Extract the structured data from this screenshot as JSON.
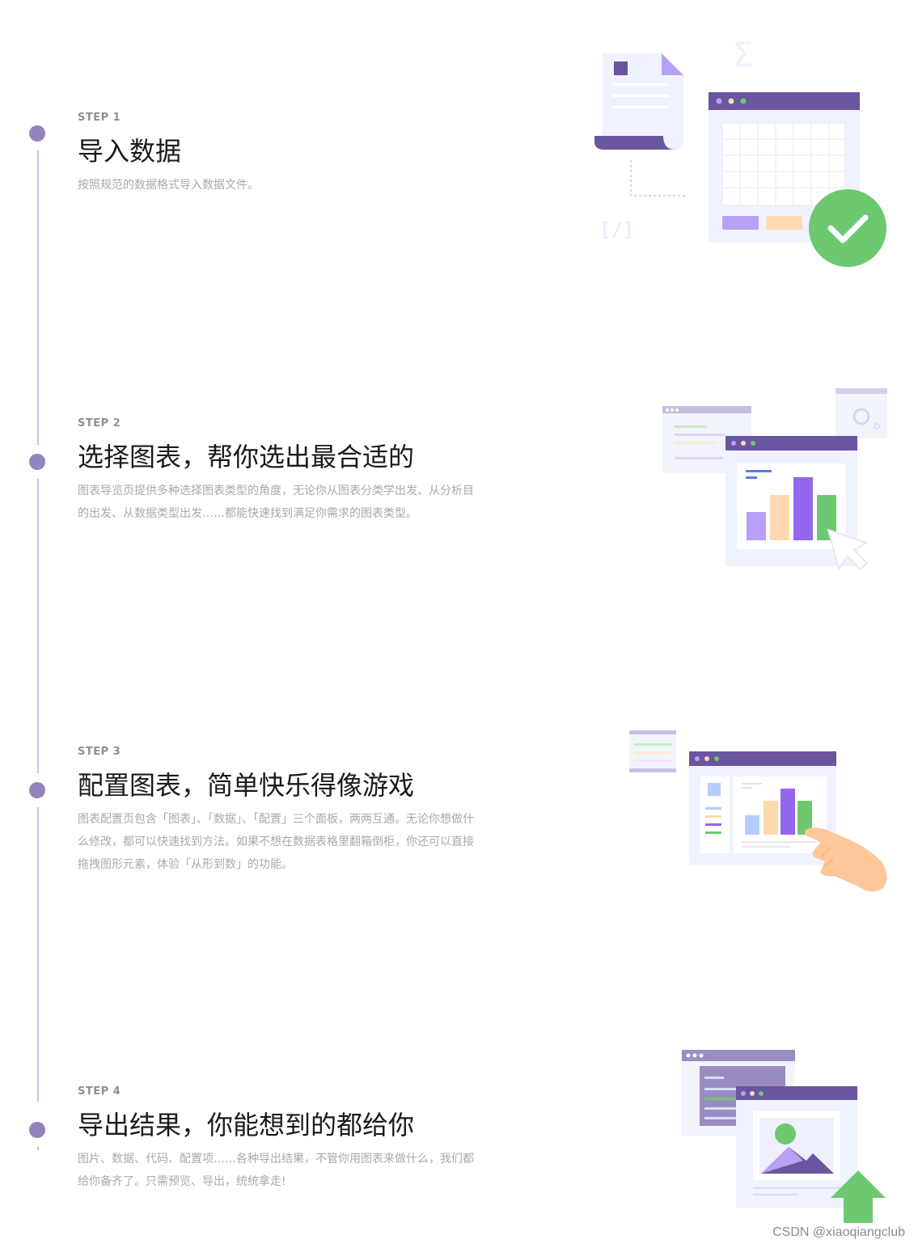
{
  "steps": [
    {
      "label": "STEP 1",
      "title": "导入数据",
      "desc": "按照规范的数据格式导入数据文件。"
    },
    {
      "label": "STEP 2",
      "title": "选择图表，帮你选出最合适的",
      "desc": "图表导览页提供多种选择图表类型的角度，无论你从图表分类学出发、从分析目的出发、从数据类型出发……都能快速找到满足你需求的图表类型。"
    },
    {
      "label": "STEP 3",
      "title": "配置图表，简单快乐得像游戏",
      "desc": "图表配置页包含「图表」、「数据」、「配置」三个面板，两两互通。无论你想做什么修改，都可以快速找到方法。如果不想在数据表格里翻箱倒柜，你还可以直接拖拽图形元素，体验「从形到数」的功能。"
    },
    {
      "label": "STEP 4",
      "title": "导出结果，你能想到的都给你",
      "desc": "图片、数据、代码、配置项……各种导出结果，不管你用图表来做什么，我们都给你备齐了。只需预览、导出，统统拿走!"
    }
  ],
  "icons": {
    "sigma": "Σ",
    "code": "[/]"
  },
  "watermark": "CSDN @xiaoqiangclub",
  "colors": {
    "accent": "#6a55a0",
    "dot": "#9484bd",
    "green": "#6cc970",
    "light_purple": "#b7a1f5",
    "peach": "#ffd9b0",
    "panel": "#eef3fd"
  }
}
